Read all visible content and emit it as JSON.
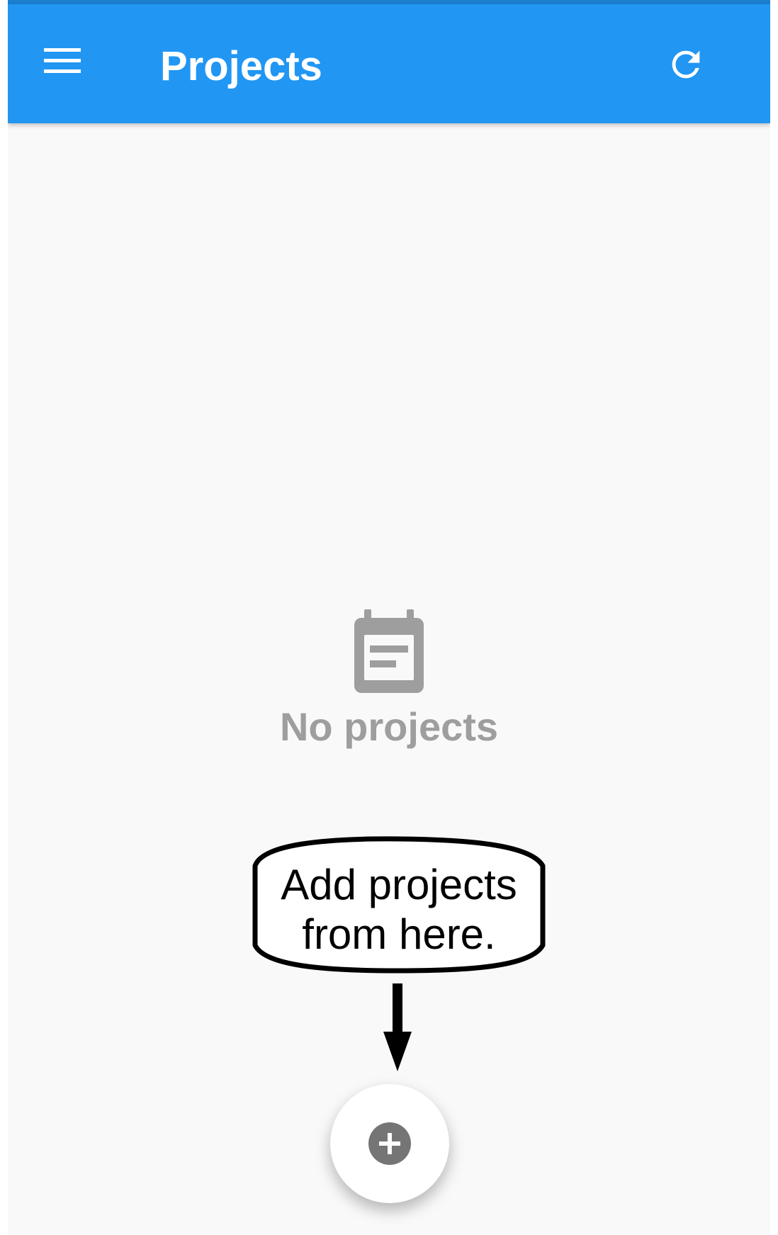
{
  "app_bar": {
    "title": "Projects",
    "background_color": "#2196f3",
    "menu_icon": "hamburger-menu-icon",
    "refresh_icon": "refresh-icon"
  },
  "empty_state": {
    "icon": "calendar-note-icon",
    "label": "No projects",
    "label_color": "#9e9e9e"
  },
  "annotation": {
    "text": "Add projects\nfrom here.",
    "arrow_icon": "down-arrow-icon"
  },
  "fab": {
    "icon": "add-circle-icon",
    "icon_color": "#757575"
  }
}
